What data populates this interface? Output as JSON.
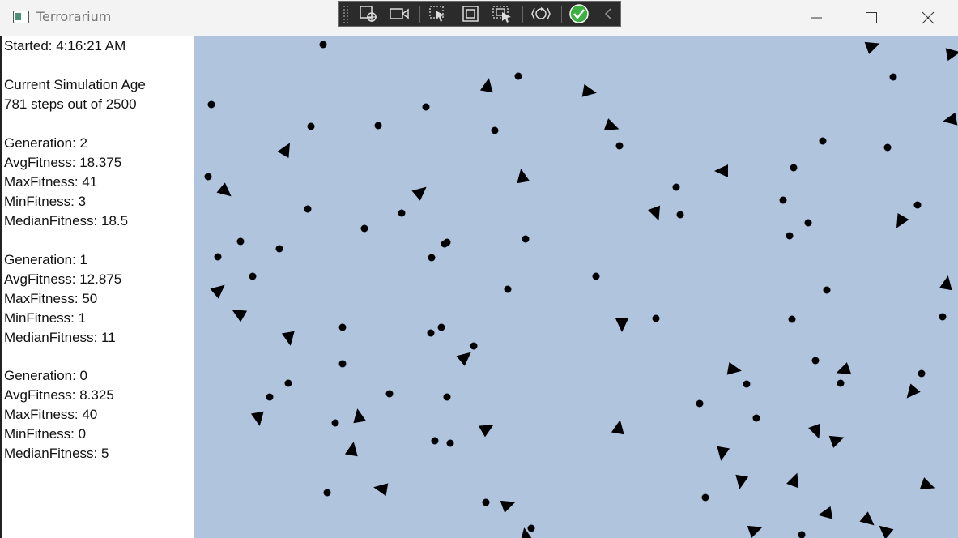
{
  "window": {
    "title": "Terrorarium"
  },
  "debug_toolbar": {
    "items": [
      "select-element-icon",
      "record-icon",
      "pointer-select-icon",
      "layout-bounds-icon",
      "track-focus-icon",
      "hot-reload-icon",
      "checkmark-icon",
      "collapse-chevron-icon"
    ]
  },
  "stats": {
    "started": "Started: 4:16:21 AM",
    "age_heading": "Current Simulation Age",
    "age_steps": "781 steps out of 2500",
    "generations": [
      {
        "generation": "Generation: 2",
        "avg": "AvgFitness: 18.375",
        "max": "MaxFitness: 41",
        "min": "MinFitness: 3",
        "median": "MedianFitness: 18.5"
      },
      {
        "generation": "Generation: 1",
        "avg": "AvgFitness: 12.875",
        "max": "MaxFitness: 50",
        "min": "MinFitness: 1",
        "median": "MedianFitness: 11"
      },
      {
        "generation": "Generation: 0",
        "avg": "AvgFitness: 8.325",
        "max": "MaxFitness: 40",
        "min": "MinFitness: 0",
        "median": "MedianFitness: 5"
      }
    ]
  },
  "simulation": {
    "background_color": "#b0c4de",
    "entity_color": "#000000"
  }
}
